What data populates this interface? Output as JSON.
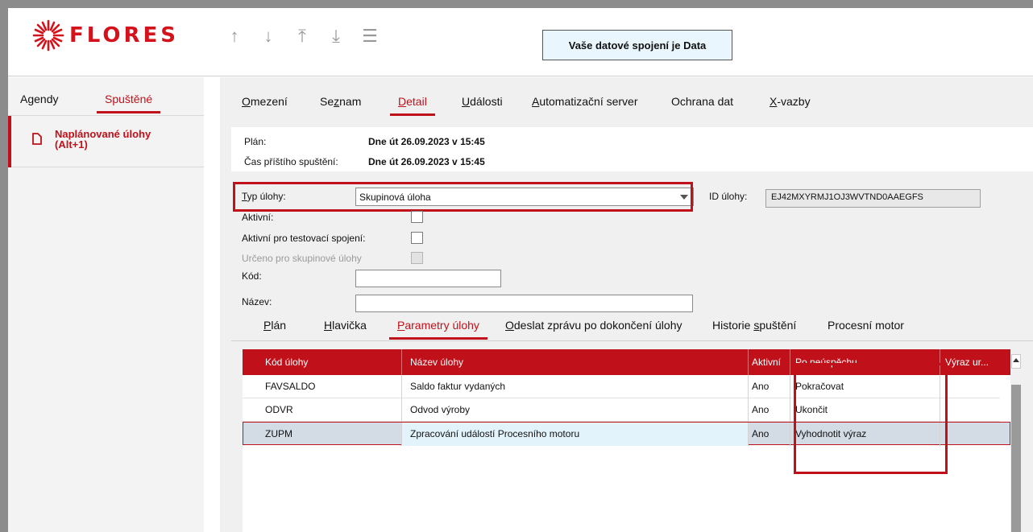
{
  "app": {
    "logo_text": "FLORES",
    "brand_color": "#c01019"
  },
  "toolbar": {
    "icons": [
      "arrow-up-icon",
      "arrow-down-icon",
      "move-to-top-icon",
      "move-to-bottom-icon",
      "menu-icon"
    ],
    "connection": "Vaše datové spojení je Data"
  },
  "sidebar": {
    "tabs": [
      {
        "label": "Agendy"
      },
      {
        "label": "Spuštěné",
        "active": true
      }
    ],
    "item": {
      "label_line1": "Naplánované úlohy",
      "label_line2": "(Alt+1)"
    }
  },
  "nav": {
    "items": [
      {
        "pre": "",
        "u": "O",
        "post": "mezení"
      },
      {
        "pre": "Se",
        "u": "z",
        "post": "nam"
      },
      {
        "pre": "",
        "u": "D",
        "post": "etail",
        "active": true
      },
      {
        "pre": "",
        "u": "U",
        "post": "dálosti"
      },
      {
        "pre": "",
        "u": "A",
        "post": "utomatizační server"
      },
      {
        "pre": "Ochrana dat",
        "u": "",
        "post": ""
      },
      {
        "pre": "",
        "u": "X",
        "post": "-vazby"
      }
    ]
  },
  "plan": {
    "plan_label": "Plán:",
    "plan_value": "Dne út 26.09.2023 v 15:45",
    "next_label": "Čas příštího spuštění:",
    "next_value": "Dne út 26.09.2023 v 15:45"
  },
  "form": {
    "type_label_u": "T",
    "type_label_rest": "yp úlohy:",
    "type_value": "Skupinová úloha",
    "id_label": "ID úlohy:",
    "id_value": "EJ42MXYRMJ1OJ3WVTND0AAEGFS",
    "active_label": "Aktivní:",
    "active_test_label": "Aktivní pro testovací spojení:",
    "group_label": "Určeno pro skupinové úlohy",
    "code_label": "Kód:",
    "name_label": "Název:",
    "code_value": "",
    "name_value": ""
  },
  "subtabs": {
    "items": [
      {
        "pre": "",
        "u": "P",
        "post": "lán"
      },
      {
        "pre": "",
        "u": "H",
        "post": "lavička"
      },
      {
        "pre": "",
        "u": "P",
        "post": "arametry úlohy",
        "active": true
      },
      {
        "pre": "",
        "u": "O",
        "post": "deslat zprávu po dokončení úlohy"
      },
      {
        "pre": "Historie ",
        "u": "s",
        "post": "puštění"
      },
      {
        "pre": "Procesní motor",
        "u": "",
        "post": ""
      }
    ]
  },
  "grid": {
    "columns": [
      "Kód úlohy",
      "Název úlohy",
      "Aktivní",
      "Po neúspěchu",
      "Výraz ur..."
    ],
    "rows": [
      [
        "FAVSALDO",
        "Saldo faktur vydaných",
        "Ano",
        "Pokračovat",
        ""
      ],
      [
        "ODVR",
        "Odvod výroby",
        "Ano",
        "Ukončit",
        ""
      ],
      [
        "ZUPM",
        "Zpracování událostí Procesního motoru",
        "Ano",
        "Vyhodnotit výraz",
        ""
      ]
    ]
  }
}
